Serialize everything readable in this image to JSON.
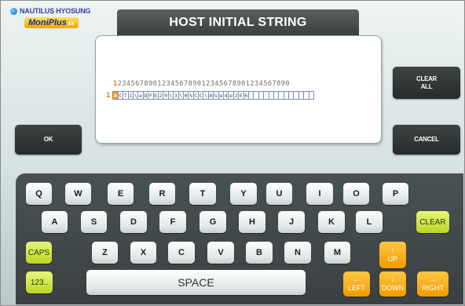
{
  "brand": {
    "company": "NAUTILUS HYOSUNG",
    "product": "MoniPlus",
    "product_suffix": "ex"
  },
  "title": "HOST INITIAL STRING",
  "editor": {
    "ruler_first": "1",
    "ruler_rest": "234567890123456789012345678901234567890",
    "row_number": "1",
    "cursor_char": "A",
    "content": "CTI\\eDFE20\\3\\0%CC\\6Ge4eJE6",
    "total_cells": 40
  },
  "buttons": {
    "clear_all": "CLEAR ALL",
    "ok": "OK",
    "cancel": "CANCEL"
  },
  "keyboard": {
    "row1": [
      "Q",
      "W",
      "E",
      "R",
      "T",
      "Y",
      "U",
      "I",
      "O",
      "P"
    ],
    "row2": [
      "A",
      "S",
      "D",
      "F",
      "G",
      "H",
      "J",
      "K",
      "L"
    ],
    "row3": [
      "Z",
      "X",
      "C",
      "V",
      "B",
      "N",
      "M"
    ],
    "clear": "CLEAR",
    "caps": "CAPS",
    "num": "123..",
    "space": "SPACE",
    "up": "UP",
    "left": "LEFT",
    "down": "DOWN",
    "right": "RIGHT"
  },
  "colors": {
    "accent_orange": "#f29a00",
    "clear_green": "#bcd426",
    "dark_button": "#2f3434"
  }
}
